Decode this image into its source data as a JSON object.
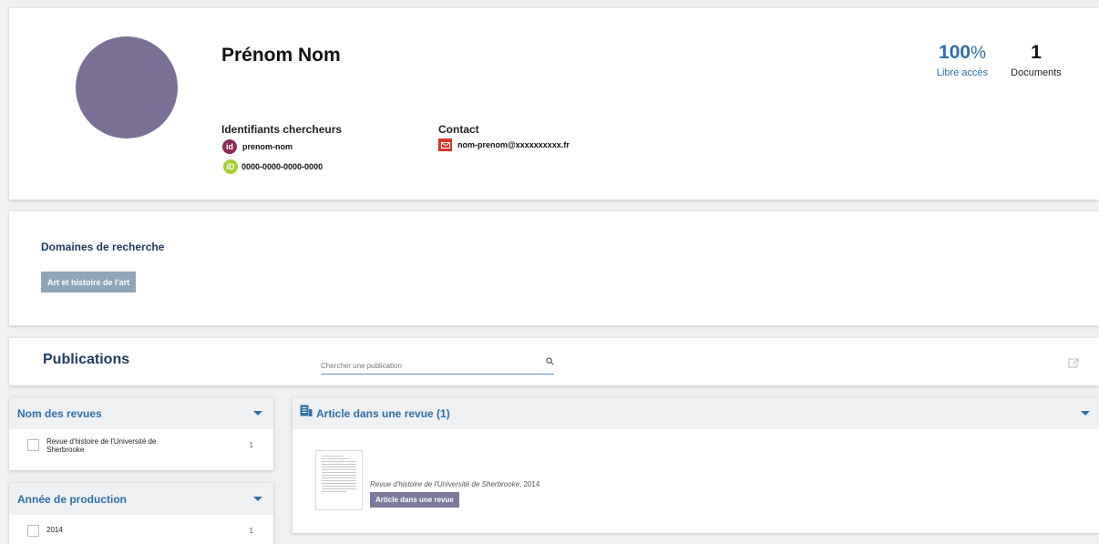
{
  "profile": {
    "name": "Prénom Nom",
    "identifiers_label": "Identifiants chercheurs",
    "idref_badge": "id",
    "idref_value": "prenom-nom",
    "orcid_badge": "iD",
    "orcid_value": "0000-0000-0000-0000",
    "contact_label": "Contact",
    "email": "nom-prenom@xxxxxxxxxx.fr",
    "avatar_color": "#7a6f94"
  },
  "stats": {
    "open_access_value": "100",
    "open_access_unit": "%",
    "open_access_label": "Libre accès",
    "documents_value": "1",
    "documents_label": "Documents"
  },
  "domains": {
    "title": "Domaines de recherche",
    "tags": [
      "Art et histoire de l'art"
    ]
  },
  "publications": {
    "title": "Publications",
    "search_placeholder": "Chercher une publication"
  },
  "filters": {
    "revues": {
      "title": "Nom des revues",
      "items": [
        {
          "label": "Revue d'histoire de l'Université de Sherbrooke",
          "count": "1"
        }
      ]
    },
    "annee": {
      "title": "Année de production",
      "items": [
        {
          "label": "2014",
          "count": "1"
        }
      ]
    }
  },
  "articles": {
    "group_title": "Article dans une revue (1)",
    "items": [
      {
        "journal": "Revue d'histoire de l'Université de Sherbrooke",
        "year_suffix": ", 2014",
        "type_badge": "Article dans une revue"
      }
    ]
  },
  "colors": {
    "accent_blue": "#2d6fa8",
    "navy": "#1e3a5f",
    "tag_bg": "#8ea5ba",
    "badge_purple": "#7c7a9c",
    "orcid_green": "#a6ce39",
    "idref_purple": "#8c2b57",
    "mail_red": "#d9342b"
  }
}
